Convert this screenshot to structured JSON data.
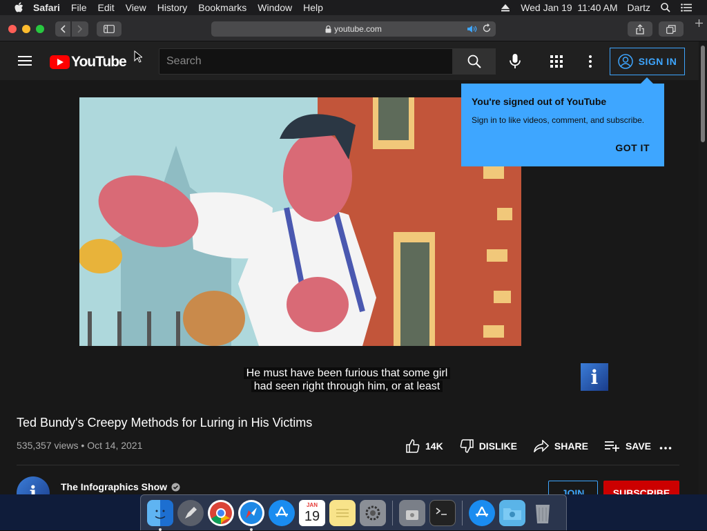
{
  "menubar": {
    "app_name": "Safari",
    "items": [
      "File",
      "Edit",
      "View",
      "History",
      "Bookmarks",
      "Window",
      "Help"
    ],
    "datetime": "Wed Jan 19  11:40 AM",
    "user": "Dartz"
  },
  "browser": {
    "url": "youtube.com"
  },
  "youtube": {
    "logo_text": "YouTube",
    "search_placeholder": "Search",
    "sign_in_label": "SIGN IN"
  },
  "tooltip": {
    "title": "You're signed out of YouTube",
    "body": "Sign in to like videos, comment, and subscribe.",
    "button": "GOT IT"
  },
  "video": {
    "caption_line1": "He must have been furious that some girl",
    "caption_line2": "had seen right through him, or at least",
    "badge_letter": "i",
    "title": "Ted Bundy's Creepy Methods for Luring in His Victims",
    "views": "535,357 views",
    "separator": "•",
    "date": "Oct 14, 2021",
    "likes": "14K",
    "dislike_label": "DISLIKE",
    "share_label": "SHARE",
    "save_label": "SAVE"
  },
  "channel": {
    "name": "The Infographics Show",
    "avatar_letter": "i",
    "join_label": "JOIN",
    "subscribe_label": "SUBSCRIBE"
  },
  "dock": {
    "calendar_month": "JAN",
    "calendar_day": "19"
  },
  "colors": {
    "accent_blue": "#3ea6ff",
    "youtube_red": "#ff0000",
    "subscribe_red": "#cc0000"
  }
}
